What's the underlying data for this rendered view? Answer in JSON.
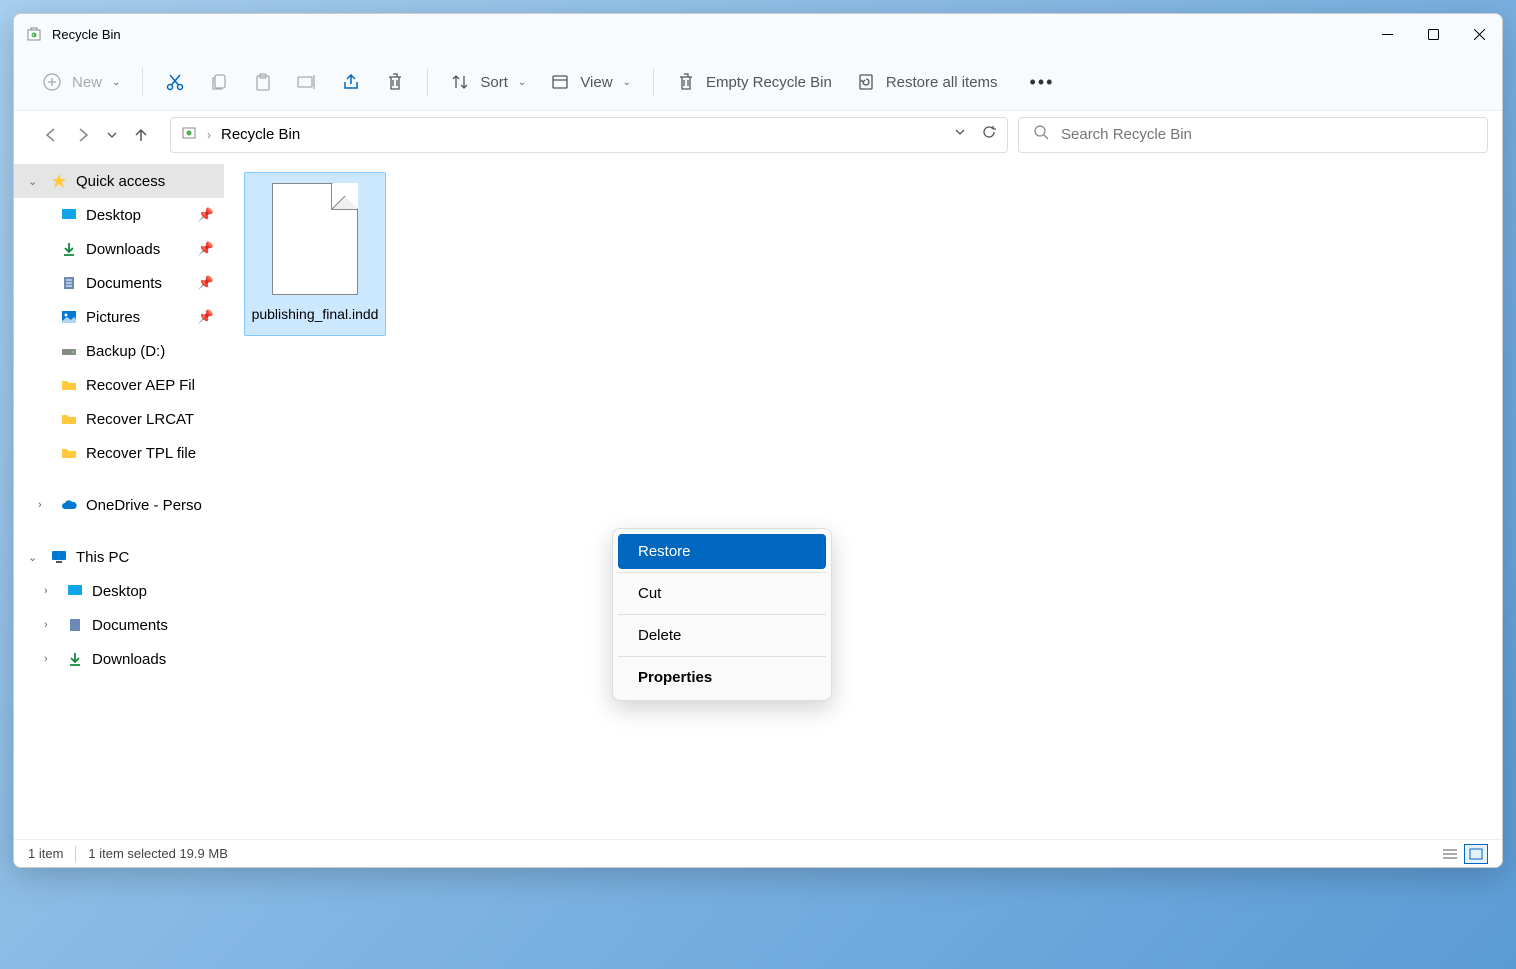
{
  "window": {
    "title": "Recycle Bin"
  },
  "toolbar": {
    "new": "New",
    "sort": "Sort",
    "view": "View",
    "empty": "Empty Recycle Bin",
    "restore_all": "Restore all items"
  },
  "breadcrumb": {
    "location": "Recycle Bin"
  },
  "search": {
    "placeholder": "Search Recycle Bin"
  },
  "sidebar": {
    "quick_access": "Quick access",
    "desktop": "Desktop",
    "downloads": "Downloads",
    "documents": "Documents",
    "pictures": "Pictures",
    "backup": "Backup (D:)",
    "recover_aep": "Recover AEP Fil",
    "recover_lrcat": "Recover LRCAT",
    "recover_tpl": "Recover TPL file",
    "onedrive": "OneDrive - Perso",
    "this_pc": "This PC",
    "pc_desktop": "Desktop",
    "pc_documents": "Documents",
    "pc_downloads": "Downloads"
  },
  "file": {
    "name": "publishing_final.indd"
  },
  "context_menu": {
    "restore": "Restore",
    "cut": "Cut",
    "delete": "Delete",
    "properties": "Properties"
  },
  "statusbar": {
    "count": "1 item",
    "selected": "1 item selected  19.9 MB"
  }
}
